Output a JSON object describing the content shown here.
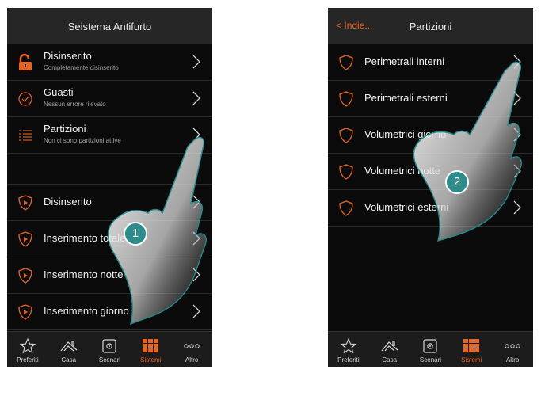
{
  "screen1": {
    "title": "Seistema Antifurto",
    "rows": [
      {
        "label": "Disinserito",
        "sub": "Completamente disinserito",
        "icon": "lock-open-icon"
      },
      {
        "label": "Guasti",
        "sub": "Nessun errore rilevato",
        "icon": "check-circle-icon"
      },
      {
        "label": "Partizioni",
        "sub": "Non ci sono partizioni attive",
        "icon": "list-icon"
      }
    ],
    "modes": [
      {
        "label": "Disinserito",
        "icon": "shield-play-icon"
      },
      {
        "label": "Inserimento totale",
        "icon": "shield-play-icon"
      },
      {
        "label": "Inserimento notte",
        "icon": "shield-play-icon"
      },
      {
        "label": "Inserimento giorno",
        "icon": "shield-play-icon"
      }
    ],
    "step": "1"
  },
  "screen2": {
    "back": "Indie...",
    "title": "Partizioni",
    "rows": [
      {
        "label": "Perimetrali interni",
        "icon": "shield-icon"
      },
      {
        "label": "Perimetrali esterni",
        "icon": "shield-icon"
      },
      {
        "label": "Volumetrici giorno",
        "icon": "shield-icon"
      },
      {
        "label": "Volumetrici notte",
        "icon": "shield-icon"
      },
      {
        "label": "Volumetrici esterni",
        "icon": "shield-icon"
      }
    ],
    "step": "2"
  },
  "tabbar": [
    {
      "label": "Preferiti",
      "icon": "star-icon",
      "active": false
    },
    {
      "label": "Casa",
      "icon": "house-icon",
      "active": false
    },
    {
      "label": "Scenari",
      "icon": "scene-icon",
      "active": false
    },
    {
      "label": "Sistemi",
      "icon": "grid-icon",
      "active": true
    },
    {
      "label": "Altro",
      "icon": "more-icon",
      "active": false
    }
  ],
  "colors": {
    "accent": "#e8651b",
    "background": "#0b0b0b",
    "titlebar": "#262626",
    "step_badge": "#2c8c8c"
  }
}
